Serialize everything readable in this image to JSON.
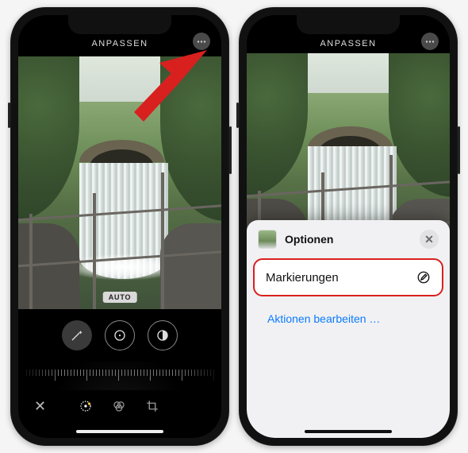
{
  "left": {
    "header_title": "ANPASSEN",
    "auto_badge": "AUTO"
  },
  "right": {
    "header_title": "ANPASSEN",
    "sheet_title": "Optionen",
    "markup_label": "Markierungen",
    "edit_actions_label": "Aktionen bearbeiten …"
  }
}
